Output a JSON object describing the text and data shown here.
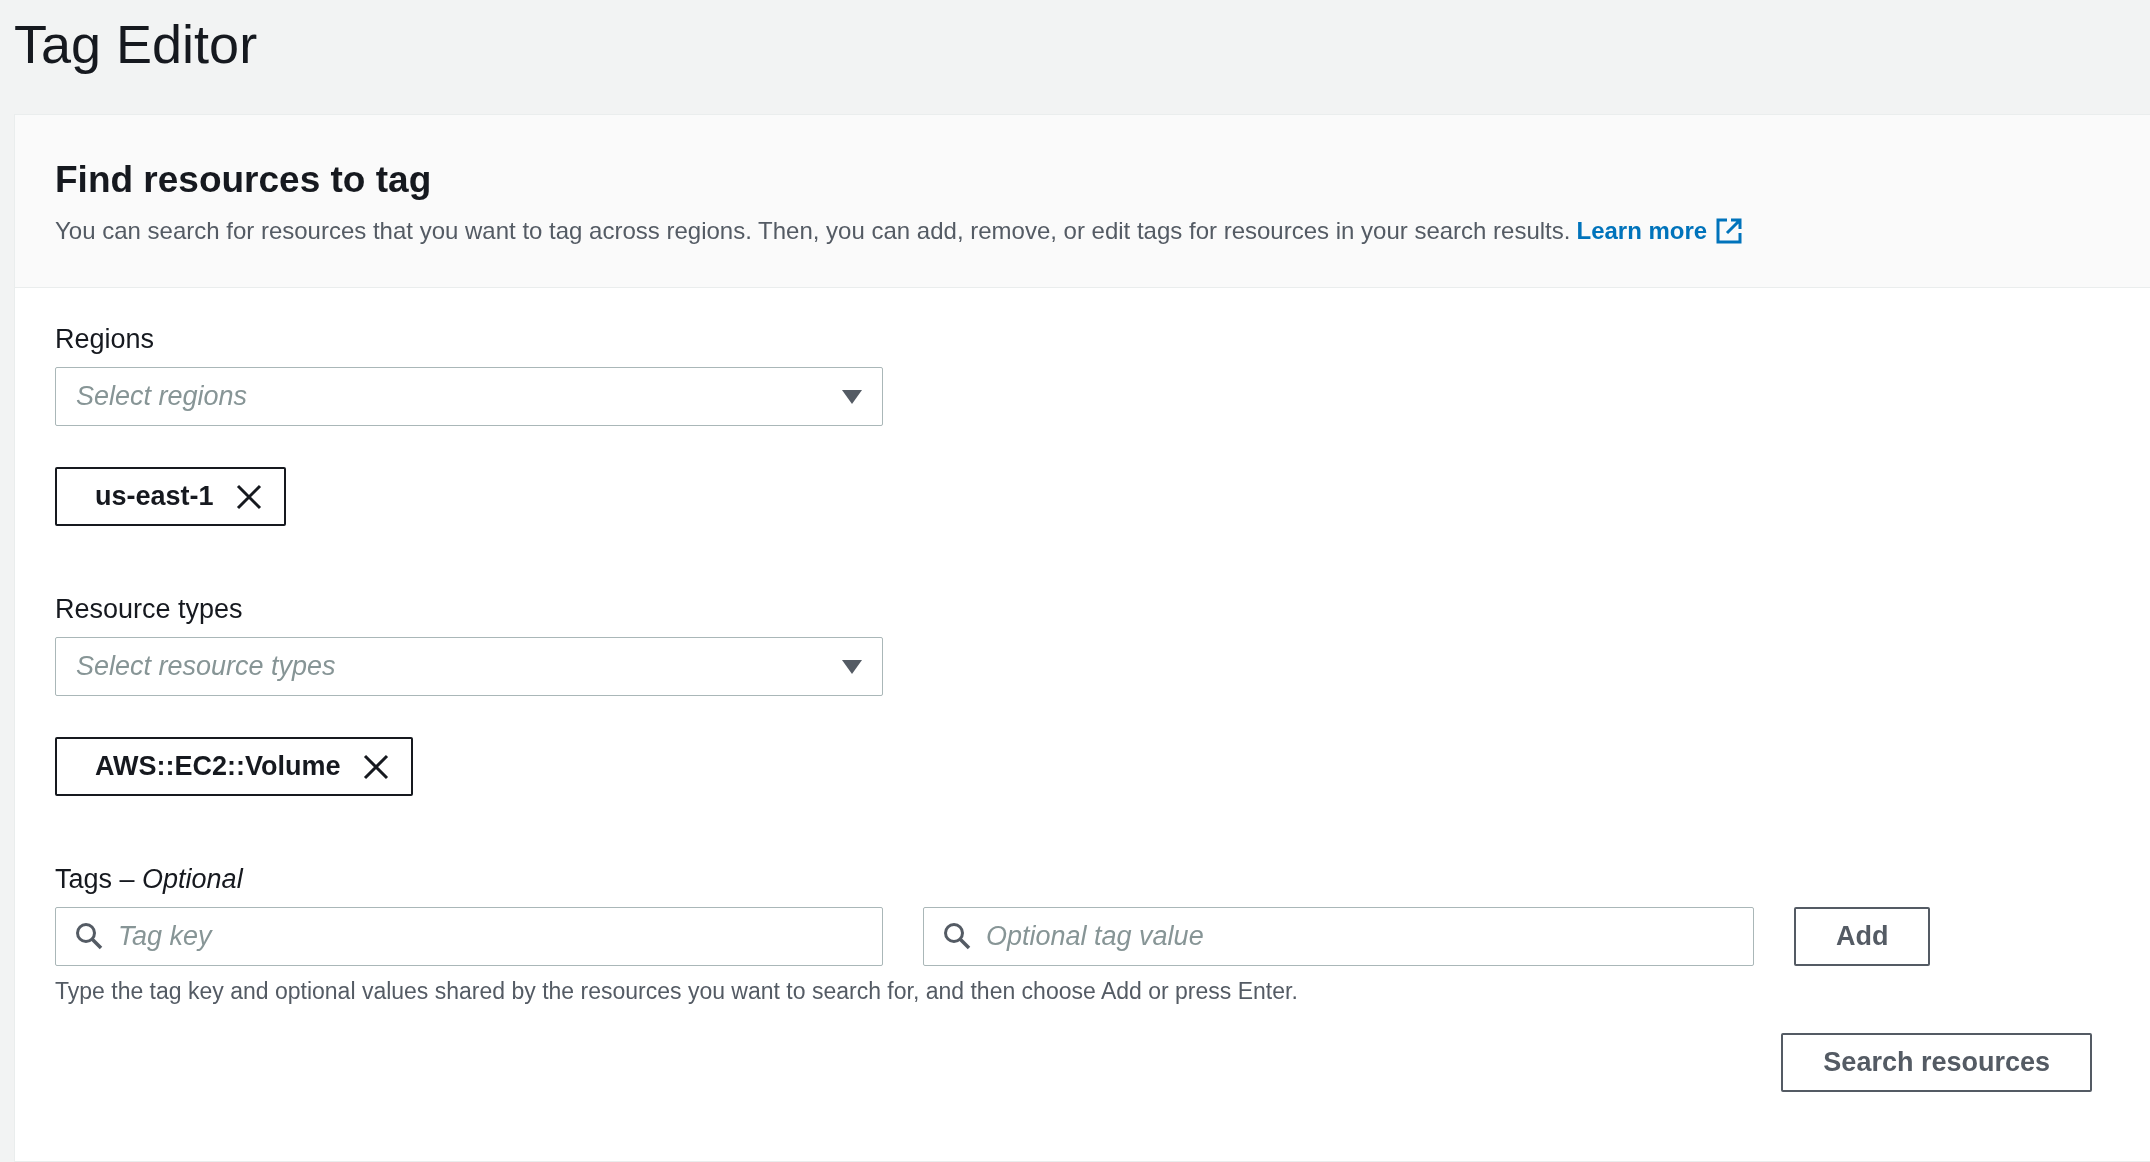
{
  "page": {
    "title": "Tag Editor"
  },
  "panel": {
    "heading": "Find resources to tag",
    "description": "You can search for resources that you want to tag across regions. Then, you can add, remove, or edit tags for resources in your search results.",
    "learn_more": "Learn more"
  },
  "regions": {
    "label": "Regions",
    "placeholder": "Select regions",
    "tokens": [
      "us-east-1"
    ]
  },
  "resource_types": {
    "label": "Resource types",
    "placeholder": "Select resource types",
    "tokens": [
      "AWS::EC2::Volume"
    ]
  },
  "tags": {
    "label": "Tags – *Optional*",
    "key_placeholder": "Tag key",
    "value_placeholder": "Optional tag value",
    "add_button": "Add",
    "hint": "Type the tag key and optional values shared by the resources you want to search for, and then choose Add or press Enter."
  },
  "search_button": "Search resources"
}
